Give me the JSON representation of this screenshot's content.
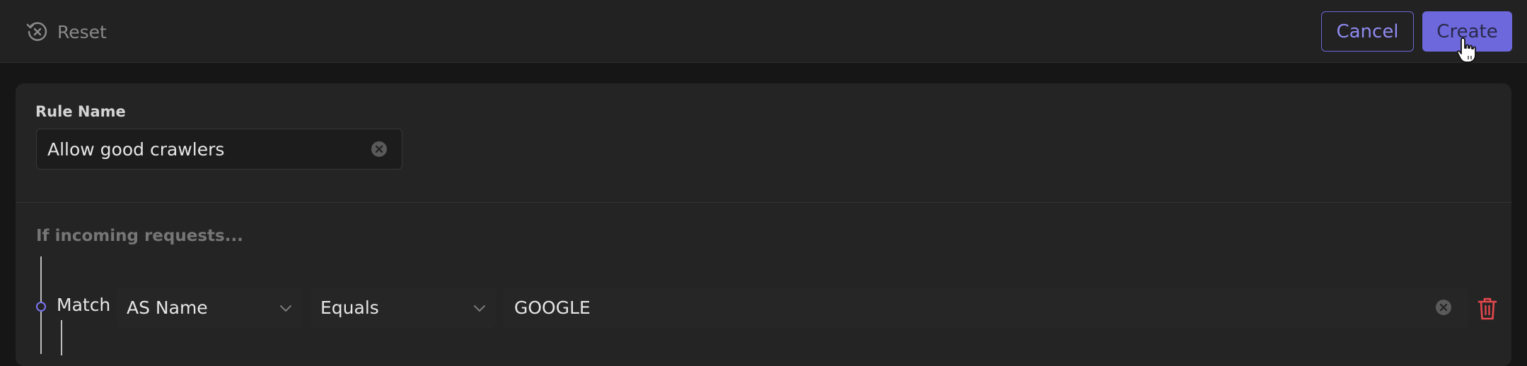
{
  "toolbar": {
    "reset_label": "Reset",
    "cancel_label": "Cancel",
    "create_label": "Create"
  },
  "rule": {
    "name_label": "Rule Name",
    "name_value": "Allow good crawlers"
  },
  "conditions": {
    "heading": "If incoming requests...",
    "rows": [
      {
        "operator": "Match",
        "field": "AS Name",
        "comparison": "Equals",
        "value": "GOOGLE"
      }
    ]
  },
  "colors": {
    "accent": "#6d68dc",
    "danger": "#e5484d",
    "background": "#161616",
    "card": "#242424"
  },
  "icons": {
    "reset": "reset-icon",
    "clear": "clear-icon",
    "chevron": "chevron-down-icon",
    "delete": "trash-icon",
    "cursor": "pointer-cursor-icon"
  }
}
